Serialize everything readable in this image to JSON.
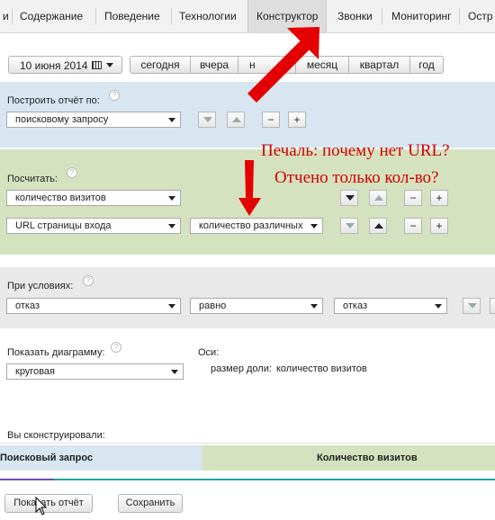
{
  "nav": {
    "items": [
      "и",
      "Содержание",
      "Поведение",
      "Технологии",
      "Конструктор",
      "Звонки",
      "Мониторинг",
      "Остр"
    ],
    "active_index": 4
  },
  "date": {
    "current": "10 июня 2014",
    "periods": [
      "сегодня",
      "вчера",
      "н",
      "месяц",
      "квартал",
      "год"
    ]
  },
  "build": {
    "title": "Построить отчёт по:",
    "help": "?",
    "select": "поисковому запросу",
    "minus": "−",
    "plus": "+"
  },
  "count": {
    "title": "Посчитать:",
    "help": "?",
    "row1_select": "количество визитов",
    "row2_select": "URL страницы входа",
    "row2_select2": "количество различных",
    "minus": "−",
    "plus": "+"
  },
  "annotation": {
    "line1": "Печаль: почему нет URL?",
    "line2": "Отчено только кол-во?"
  },
  "conditions": {
    "title": "При условиях:",
    "help": "?",
    "field": "отказ",
    "operator": "равно",
    "value": "отказ"
  },
  "chart": {
    "title": "Показать диаграмму:",
    "help": "?",
    "select": "круговая",
    "axes_label": "Оси:",
    "share_label": "размер доли:",
    "share_value": "количество визитов"
  },
  "constructed": {
    "label": "Вы сконструировали:",
    "columns": [
      "Поисковый запрос",
      "Количество визитов"
    ]
  },
  "footer": {
    "show_report": "Показать отчёт",
    "save": "Сохранить"
  },
  "colors": {
    "blue_section": "#d7e6f1",
    "green_section": "#d5e2bf",
    "gray_section": "#e9e9e9",
    "arrow_red": "#e40000",
    "accent_line": "#23a6a3"
  }
}
